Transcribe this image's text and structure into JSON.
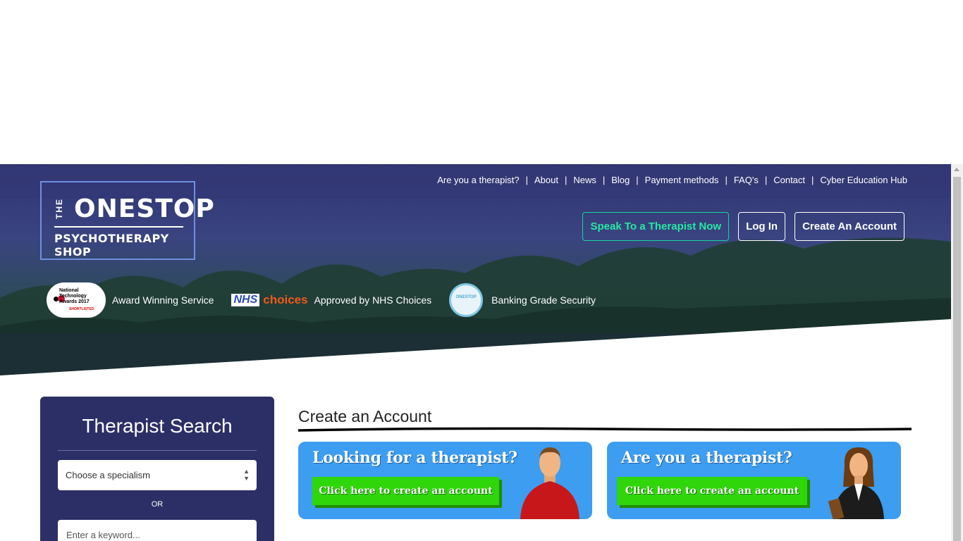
{
  "brand": {
    "logo_the": "THE",
    "logo_onestop": "ONESTOP",
    "logo_subtitle": "PSYCHOTHERAPY SHOP"
  },
  "top_nav": {
    "items": [
      "Are you a therapist?",
      "About",
      "News",
      "Blog",
      "Payment methods",
      "FAQ's",
      "Contact",
      "Cyber Education Hub"
    ]
  },
  "header_buttons": {
    "speak": "Speak To a Therapist Now",
    "login": "Log In",
    "create": "Create An Account"
  },
  "badges": {
    "award_logo_lines": [
      "National",
      "Technology",
      "Awards 2017"
    ],
    "award_logo_sub": "SHORTLISTED",
    "award_text": "Award Winning Service",
    "nhs_logo": "NHS",
    "nhs_choices": "choices",
    "nhs_text": "Approved by NHS Choices",
    "security_logo": "ONESTOP",
    "security_text": "Banking Grade Security"
  },
  "search": {
    "title": "Therapist Search",
    "specialism_selected": "Choose a specialism",
    "or_label": "OR",
    "keyword_placeholder": "Enter a keyword..."
  },
  "create_account": {
    "title": "Create an Account",
    "cards": [
      {
        "question": "Looking for a therapist?",
        "cta": "Click here to create an account",
        "figure": "man-avatar-icon"
      },
      {
        "question": "Are you a therapist?",
        "cta": "Click here to create an account",
        "figure": "woman-avatar-icon"
      }
    ]
  },
  "colors": {
    "hero_overlay": "#343876",
    "accent_green": "#27e8a4",
    "panel_navy": "#2c2f66",
    "card_blue": "#3d9df0",
    "cta_green": "#2fd60a"
  }
}
